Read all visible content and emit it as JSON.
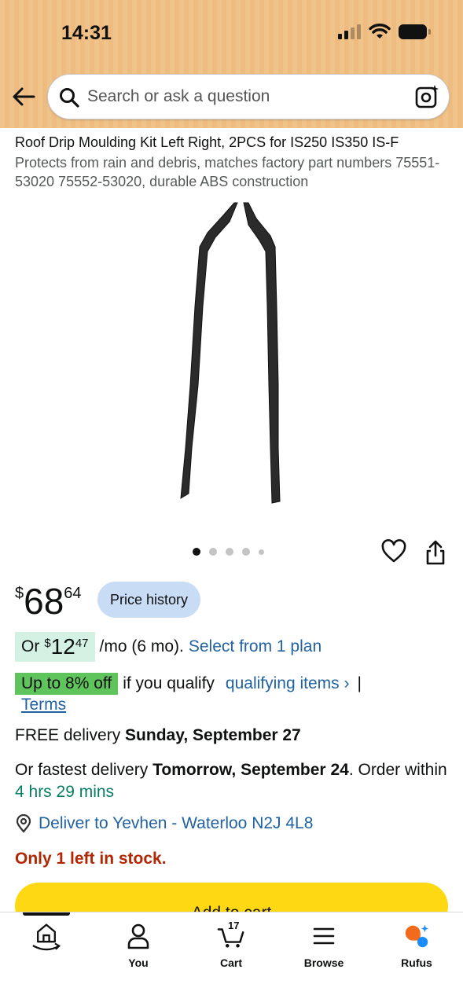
{
  "status_bar": {
    "time": "14:31"
  },
  "search": {
    "placeholder": "Search or ask a question"
  },
  "product": {
    "title": "Roof Drip Moulding Kit Left Right, 2PCS for IS250 IS350 IS-F",
    "subtitle": "Protects from rain and debris, matches factory part numbers 75551-53020 75552-53020, durable ABS construction",
    "image_count": 5,
    "active_image": 1
  },
  "price": {
    "symbol": "$",
    "whole": "68",
    "fraction": "64",
    "history_label": "Price history"
  },
  "monthly": {
    "prefix": "Or",
    "symbol": "$",
    "whole": "12",
    "fraction": "47",
    "suffix": "/mo (6 mo).",
    "plan_link": "Select from 1 plan"
  },
  "discount": {
    "badge": "Up to 8% off",
    "text": "if you qualify",
    "link": "qualifying items ›",
    "separator": "|",
    "terms": "Terms"
  },
  "delivery": {
    "free_prefix": "FREE delivery",
    "free_date": "Sunday, September 27",
    "fastest_prefix": "Or fastest delivery",
    "fastest_date": "Tomorrow, September 24",
    "order_within": ". Order within",
    "countdown": "4 hrs 29 mins",
    "deliver_to": "Deliver to Yevhen - Waterloo N2J 4L8"
  },
  "stock": "Only 1 left in stock.",
  "add_to_cart": "Add to cart",
  "bottom_nav": {
    "items": [
      {
        "label": "",
        "icon": "home-icon"
      },
      {
        "label": "You",
        "icon": "person-icon"
      },
      {
        "label": "Cart",
        "icon": "cart-icon",
        "count": "17"
      },
      {
        "label": "Browse",
        "icon": "menu-icon"
      },
      {
        "label": "Rufus",
        "icon": "rufus-icon"
      }
    ]
  },
  "colors": {
    "header": "#f0c38a",
    "link": "#2162a1",
    "green_text": "#067d62",
    "stock_red": "#b12704",
    "cta_yellow": "#ffd814",
    "discount_green": "#5fc45b",
    "monthly_bg": "#d3f2e3",
    "price_history_bg": "#c9dcf5"
  }
}
